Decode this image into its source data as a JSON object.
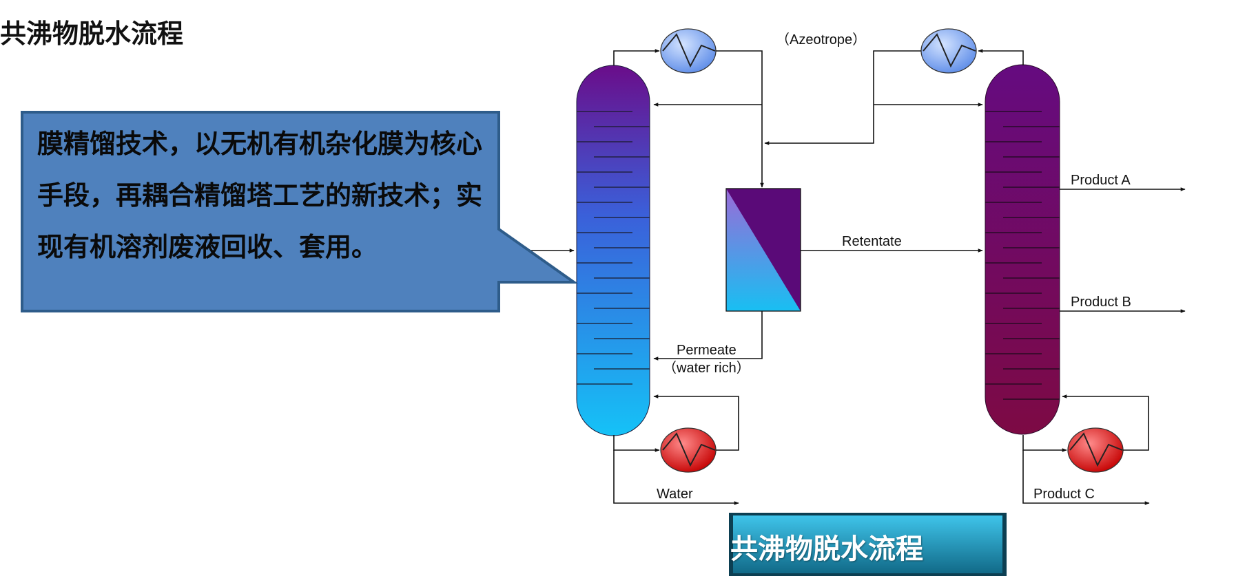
{
  "page": {
    "title": "共沸物脱水流程"
  },
  "callout": {
    "text": "膜精馏技术，以无机有机杂化膜为核心手段，再耦合精馏塔工艺的新技术；实现有机溶剂废液回收、套用。"
  },
  "diagram": {
    "labels": {
      "azeotrope": "（Azeotrope）",
      "retentate": "Retentate",
      "permeate": "Permeate",
      "water_rich": "（water rich）",
      "water": "Water",
      "product_a": "Product A",
      "product_b": "Product B",
      "product_c": "Product C"
    },
    "colors": {
      "left_column_top": "#6a0d8a",
      "left_column_bottom": "#15b8f5",
      "right_column_top": "#6a0b78",
      "right_column_bottom": "#7a0a45",
      "condenser": "#8fb6f5",
      "reboiler": "#e31b1b",
      "callout_fill": "#4f81bd",
      "caption_fill": "#1a7fa0"
    },
    "icons": [
      "condenser-icon",
      "reboiler-icon",
      "membrane-module-icon"
    ]
  },
  "caption": {
    "text": "共沸物脱水流程"
  }
}
